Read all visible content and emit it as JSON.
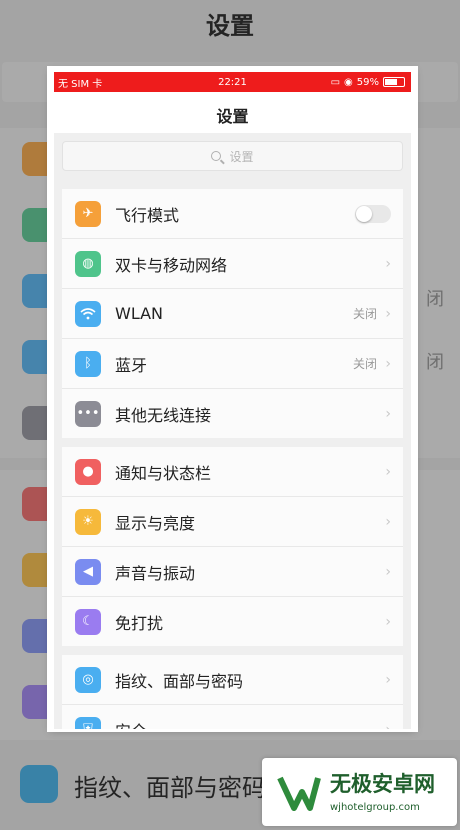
{
  "background": {
    "title": "设置",
    "bottom_item_label": "指纹、面部与密码",
    "right_values": [
      "闭",
      "闭"
    ]
  },
  "status_bar": {
    "carrier": "无 SIM 卡",
    "time": "22:21",
    "battery": "59%"
  },
  "page_title": "设置",
  "search": {
    "placeholder": "设置"
  },
  "groups": [
    {
      "items": [
        {
          "label": "飞行模式",
          "icon": "airplane-icon",
          "color": "#f5a03a",
          "toggle": true
        },
        {
          "label": "双卡与移动网络",
          "icon": "globe-icon",
          "color": "#4fc48b"
        },
        {
          "label": "WLAN",
          "icon": "wifi-icon",
          "color": "#4aaef0",
          "value": "关闭"
        },
        {
          "label": "蓝牙",
          "icon": "bluetooth-icon",
          "color": "#4aaef0",
          "value": "关闭"
        },
        {
          "label": "其他无线连接",
          "icon": "more-dots-icon",
          "color": "#8c8c95"
        }
      ]
    },
    {
      "items": [
        {
          "label": "通知与状态栏",
          "icon": "notification-icon",
          "color": "#f06060"
        },
        {
          "label": "显示与亮度",
          "icon": "brightness-icon",
          "color": "#f6b93b"
        },
        {
          "label": "声音与振动",
          "icon": "speaker-icon",
          "color": "#7a8cf0"
        },
        {
          "label": "免打扰",
          "icon": "moon-icon",
          "color": "#9a7cf0"
        }
      ]
    },
    {
      "items": [
        {
          "label": "指纹、面部与密码",
          "icon": "fingerprint-face-icon",
          "color": "#4aaef0"
        },
        {
          "label": "安全",
          "icon": "shield-icon",
          "color": "#4aaef0"
        }
      ]
    }
  ],
  "watermark": {
    "title": "无极安卓网",
    "url": "wjhotelgroup.com"
  }
}
